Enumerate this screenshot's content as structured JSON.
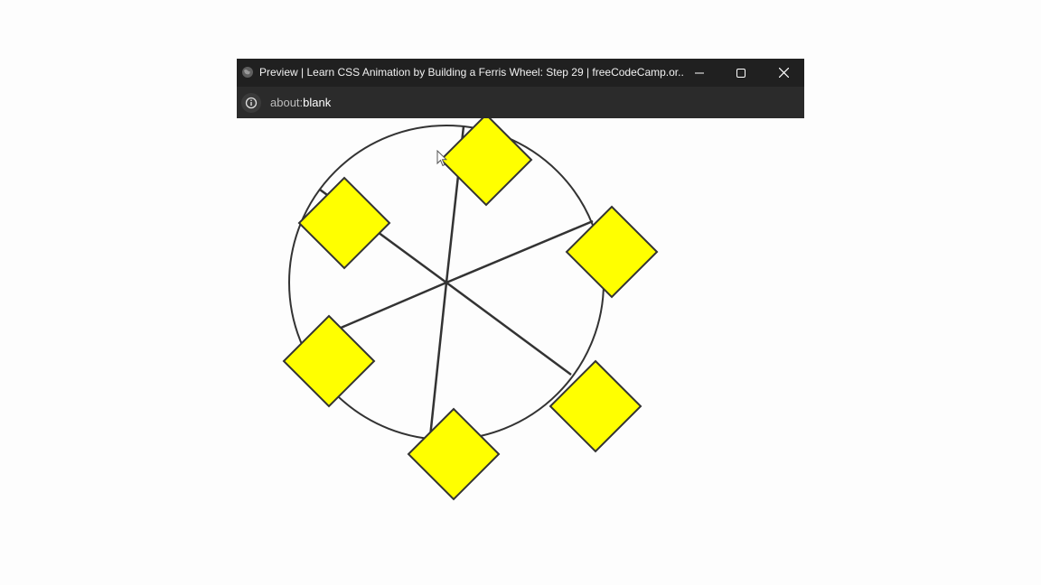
{
  "window": {
    "title": "Preview | Learn CSS Animation by Building a Ferris Wheel: Step 29 | freeCodeCamp.or...",
    "controls": {
      "minimize_icon": "minimize-icon",
      "maximize_icon": "maximize-icon",
      "close_icon": "close-icon"
    },
    "favicon_icon": "globe-icon"
  },
  "address_bar": {
    "info_icon": "info-icon",
    "url_scheme": "about:",
    "url_rest": "blank"
  },
  "ferris_wheel": {
    "spoke_count": 6,
    "cabin_count": 6,
    "cabin_color": "#ffff00",
    "line_color": "#333333"
  }
}
